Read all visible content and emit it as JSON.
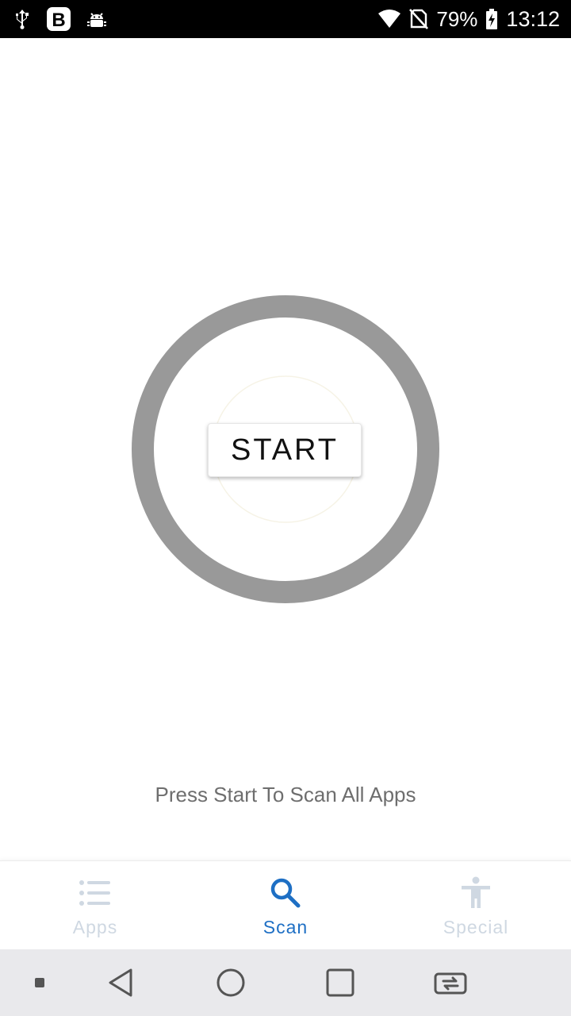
{
  "status_bar": {
    "battery_percent": "79%",
    "time": "13:12",
    "left_icons": [
      "usb-icon",
      "b-app-icon",
      "android-debug-icon"
    ],
    "right_icons": [
      "wifi-icon",
      "no-sim-icon",
      "battery-charging-icon"
    ]
  },
  "main": {
    "start_label": "START",
    "hint": "Press Start To Scan All Apps",
    "ring_color": "#999999"
  },
  "bottom_nav": {
    "items": [
      {
        "label": "Apps",
        "icon": "list-icon",
        "active": false
      },
      {
        "label": "Scan",
        "icon": "search-icon",
        "active": true
      },
      {
        "label": "Special",
        "icon": "accessibility-icon",
        "active": false
      }
    ],
    "active_color": "#1e6fc4",
    "inactive_color": "#cfd8e2"
  },
  "system_nav": {
    "buttons": [
      "menu-dot-icon",
      "back-icon",
      "home-icon",
      "recents-icon",
      "switch-app-icon"
    ]
  }
}
